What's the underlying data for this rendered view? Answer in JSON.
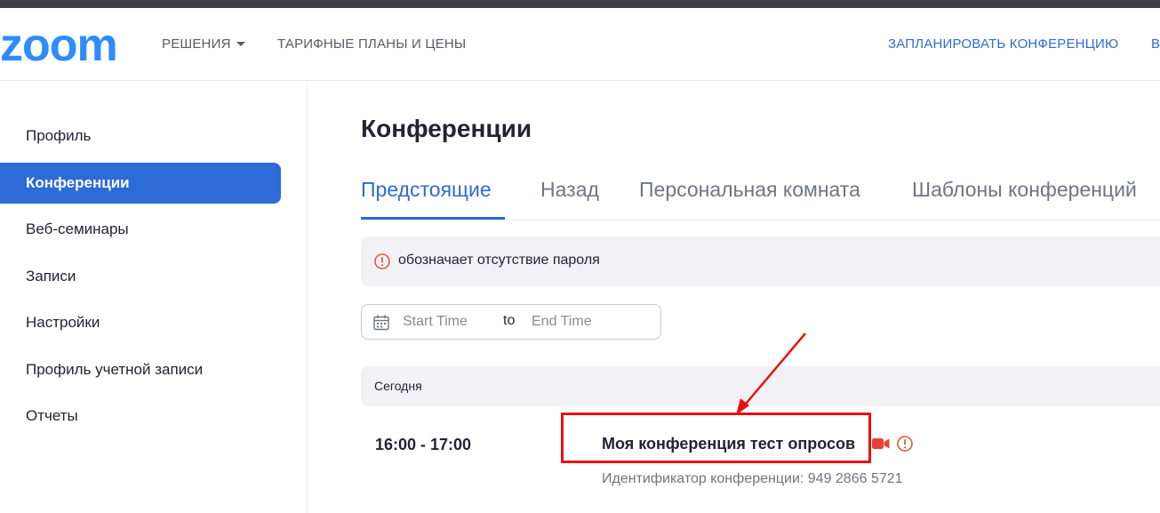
{
  "header": {
    "brand": "zoom",
    "nav": {
      "solutions": "РЕШЕНИЯ",
      "plans": "ТАРИФНЫЕ ПЛАНЫ И ЦЕНЫ",
      "schedule": "ЗАПЛАНИРОВАТЬ КОНФЕРЕНЦИЮ",
      "cut": "В"
    }
  },
  "sidebar": {
    "items": [
      {
        "label": "Профиль"
      },
      {
        "label": "Конференции"
      },
      {
        "label": "Веб-семинары"
      },
      {
        "label": "Записи"
      },
      {
        "label": "Настройки"
      },
      {
        "label": "Профиль учетной записи"
      },
      {
        "label": "Отчеты"
      }
    ],
    "active_index": 1
  },
  "main": {
    "title": "Конференции",
    "tabs": [
      {
        "label": "Предстоящие"
      },
      {
        "label": "Назад"
      },
      {
        "label": "Персональная комната"
      },
      {
        "label": "Шаблоны конференций"
      }
    ],
    "notice": "обозначает отсутствие пароля",
    "date_range": {
      "start_placeholder": "Start Time",
      "to": "to",
      "end_placeholder": "End Time"
    },
    "group_label": "Сегодня",
    "meeting": {
      "time": "16:00 - 17:00",
      "title": "Моя конференция тест опросов",
      "id_text": "Идентификатор конференции: 949 2866 5721"
    }
  },
  "icons": {
    "calendar": "calendar-icon",
    "warning": "exclamation-circle-icon",
    "video": "video-camera-icon",
    "caret": "caret-down-icon"
  },
  "colors": {
    "accent": "#2d6bd6",
    "logo": "#2d8cff",
    "warning": "#e05a3a",
    "video": "#e8403a",
    "annotation": "#e8100f"
  }
}
